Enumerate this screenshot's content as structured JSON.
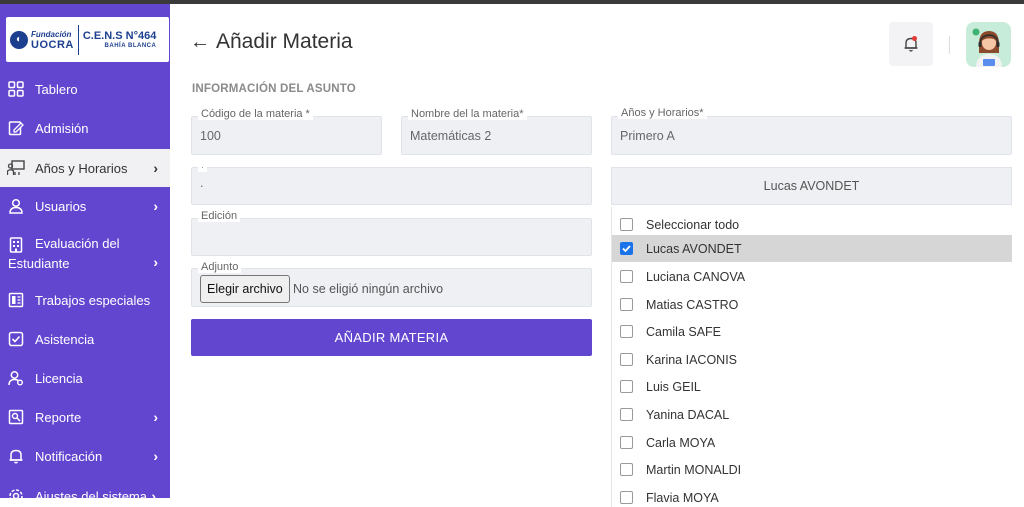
{
  "logo": {
    "fundacion": "Fundación",
    "uocra": "UOCRA",
    "cens": "C.E.N.S N°464",
    "location": "BAHÍA BLANCA"
  },
  "sidebar": {
    "items": [
      {
        "label": "Tablero",
        "icon": "dashboard-icon"
      },
      {
        "label": "Admisión",
        "icon": "edit-icon"
      },
      {
        "label": "Años y Horarios",
        "icon": "classroom-icon"
      },
      {
        "label": "Usuarios",
        "icon": "user-icon"
      },
      {
        "label": "Evaluación del",
        "label2": "Estudiante",
        "icon": "building-icon"
      },
      {
        "label": "Trabajos especiales",
        "icon": "book-icon"
      },
      {
        "label": "Asistencia",
        "icon": "checkbox-icon"
      },
      {
        "label": "Licencia",
        "icon": "user-license-icon"
      },
      {
        "label": "Reporte",
        "icon": "report-icon"
      },
      {
        "label": "Notificación",
        "icon": "bell-icon"
      },
      {
        "label": "Ajustes del sistema",
        "icon": "gear-icon"
      }
    ]
  },
  "header": {
    "title": "Añadir Materia",
    "back_icon": "arrow-left-icon",
    "bell_icon": "bell-icon"
  },
  "form": {
    "section_label": "INFORMACIÓN DEL ASUNTO",
    "codigo": {
      "label": "Código de la materia *",
      "value": "100"
    },
    "nombre": {
      "label": "Nombre del la materia*",
      "value": "Matemáticas 2"
    },
    "anios": {
      "label": "Años y Horarios*",
      "value": "Primero A"
    },
    "unnamed": {
      "label": "·",
      "value": "."
    },
    "edicion": {
      "label": "Edición",
      "value": ""
    },
    "adjunto": {
      "label": "Adjunto",
      "button": "Elegir archivo",
      "status": "No se eligió ningún archivo"
    },
    "submit_label": "AÑADIR MATERIA"
  },
  "teacher_dropdown": {
    "selected": "Lucas AVONDET",
    "options": [
      {
        "label": "Seleccionar todo",
        "checked": false
      },
      {
        "label": "Lucas AVONDET",
        "checked": true
      },
      {
        "label": "Luciana CANOVA",
        "checked": false
      },
      {
        "label": "Matias CASTRO",
        "checked": false
      },
      {
        "label": "Camila SAFE",
        "checked": false
      },
      {
        "label": "Karina IACONIS",
        "checked": false
      },
      {
        "label": "Luis GEIL",
        "checked": false
      },
      {
        "label": "Yanina DACAL",
        "checked": false
      },
      {
        "label": "Carla MOYA",
        "checked": false
      },
      {
        "label": "Martin MONALDI",
        "checked": false
      },
      {
        "label": "Flavia MOYA",
        "checked": false
      }
    ]
  },
  "colors": {
    "primary": "#6246d0",
    "checkbox": "#1a73e8",
    "notification_dot": "#e53935"
  }
}
